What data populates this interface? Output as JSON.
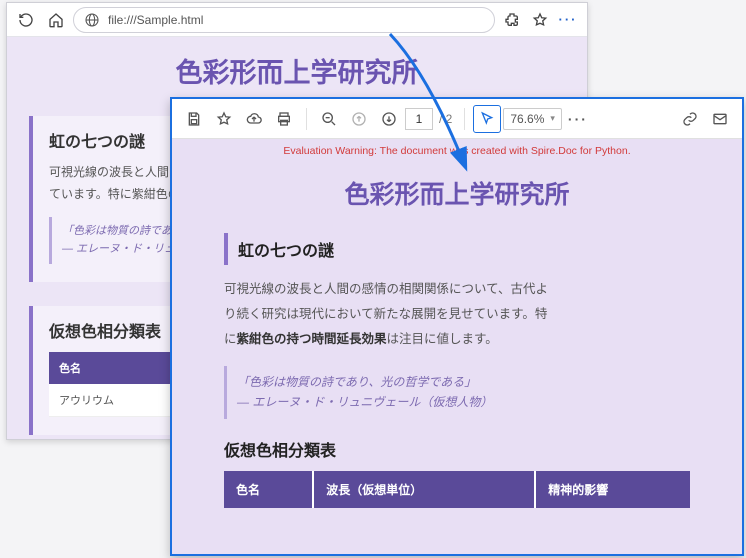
{
  "browser": {
    "url": "file:///Sample.html",
    "title": "色彩形而上学研究所",
    "section1": {
      "heading": "虹の七つの謎",
      "para": "可視光線の波長と人間の",
      "para2": "ています。特に紫紺色の",
      "quote1": "「色彩は物質の詩であ",
      "quote2": "— エレーヌ・ド・リュ"
    },
    "section2": {
      "heading": "仮想色相分類表",
      "col1": "色名",
      "row1": "アウリウム"
    }
  },
  "pdf": {
    "page_current": "1",
    "page_total": "/ 2",
    "zoom": "76.6%",
    "warning": "Evaluation Warning: The document was created with Spire.Doc for Python.",
    "title": "色彩形而上学研究所",
    "sec1_heading": "虹の七つの謎",
    "sec1_para_a": "可視光線の波長と人間の感情の相関関係について、古代よ",
    "sec1_para_b": "り続く研究は現代において新たな展開を見せています。特",
    "sec1_para_c_pre": "に",
    "sec1_para_c_bold": "紫紺色の持つ時間延長効果",
    "sec1_para_c_post": "は注目に値します。",
    "quote_line1": "「色彩は物質の詩であり、光の哲学である」",
    "quote_line2": "— エレーヌ・ド・リュニヴェール（仮想人物）",
    "sec2_heading": "仮想色相分類表",
    "tbl_h1": "色名",
    "tbl_h2": "波長（仮想単位）",
    "tbl_h3": "精神的影響"
  }
}
